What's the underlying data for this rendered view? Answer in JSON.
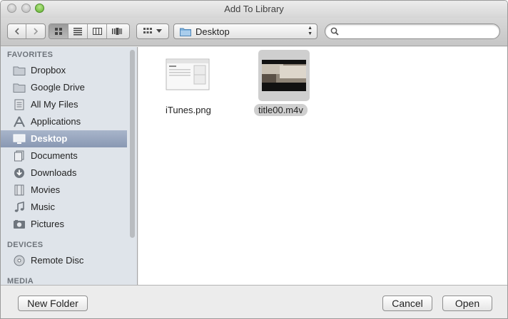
{
  "window": {
    "title": "Add To Library"
  },
  "toolbar": {
    "location": "Desktop",
    "search": {
      "value": "",
      "placeholder": ""
    },
    "view_modes": [
      "icon-view",
      "list-view",
      "column-view",
      "cover-flow-view"
    ],
    "active_view": "icon-view"
  },
  "sidebar": {
    "sections": [
      {
        "header": "FAVORITES",
        "items": [
          {
            "label": "Dropbox",
            "icon": "folder-icon"
          },
          {
            "label": "Google Drive",
            "icon": "folder-icon"
          },
          {
            "label": "All My Files",
            "icon": "all-files-icon"
          },
          {
            "label": "Applications",
            "icon": "applications-icon"
          },
          {
            "label": "Desktop",
            "icon": "desktop-icon",
            "selected": true
          },
          {
            "label": "Documents",
            "icon": "documents-icon"
          },
          {
            "label": "Downloads",
            "icon": "downloads-icon"
          },
          {
            "label": "Movies",
            "icon": "movies-icon"
          },
          {
            "label": "Music",
            "icon": "music-icon"
          },
          {
            "label": "Pictures",
            "icon": "pictures-icon"
          }
        ]
      },
      {
        "header": "DEVICES",
        "items": [
          {
            "label": "Remote Disc",
            "icon": "disc-icon"
          }
        ]
      },
      {
        "header": "MEDIA",
        "items": []
      }
    ]
  },
  "files": [
    {
      "name": "iTunes.png",
      "selected": false
    },
    {
      "name": "title00.m4v",
      "selected": true
    }
  ],
  "footer": {
    "new_folder": "New Folder",
    "cancel": "Cancel",
    "open": "Open"
  },
  "colors": {
    "sidebar_bg": "#dfe4ea",
    "selection": "#8998b3",
    "window_bg": "#ececec"
  }
}
